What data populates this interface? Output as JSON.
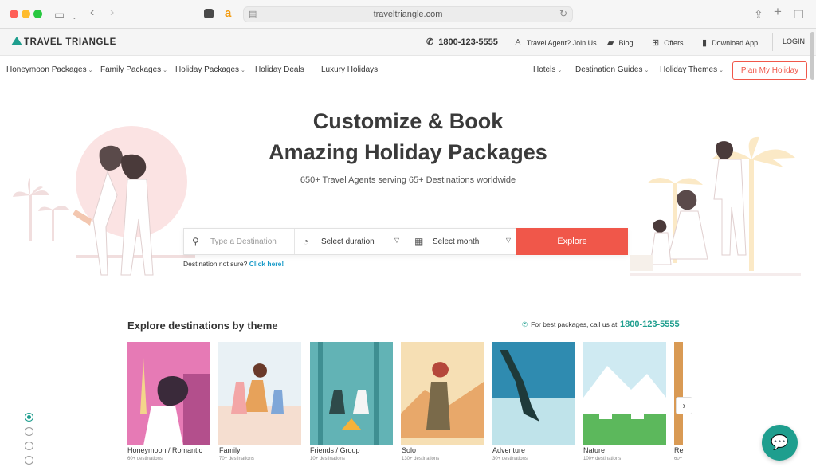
{
  "browser": {
    "url": "traveltriangle.com"
  },
  "topbar": {
    "logo": "TRAVEL TRIANGLE",
    "phone": "1800-123-5555",
    "travel_agent": "Travel Agent? Join Us",
    "blog": "Blog",
    "offers": "Offers",
    "download_app": "Download App",
    "login": "LOGIN"
  },
  "nav": {
    "items_left": [
      "Honeymoon Packages",
      "Family Packages",
      "Holiday Packages",
      "Holiday Deals",
      "Luxury Holidays"
    ],
    "items_right": [
      "Hotels",
      "Destination Guides",
      "Holiday Themes"
    ],
    "plan_button": "Plan My Holiday"
  },
  "hero": {
    "title_line1": "Customize & Book",
    "title_line2": "Amazing Holiday Packages",
    "subtitle": "650+ Travel Agents serving 65+ Destinations worldwide"
  },
  "search": {
    "destination_placeholder": "Type a Destination",
    "duration": "Select duration",
    "month": "Select month",
    "explore": "Explore",
    "not_sure_text": "Destination not sure?",
    "click_here": "Click here!"
  },
  "themes": {
    "title": "Explore destinations by theme",
    "callus_text": "For best packages, call us at",
    "callus_number": "1800-123-5555",
    "cards": [
      {
        "name": "Honeymoon / Romantic",
        "sub": "60+ destinations"
      },
      {
        "name": "Family",
        "sub": "70+ destinations"
      },
      {
        "name": "Friends / Group",
        "sub": "10+ destinations"
      },
      {
        "name": "Solo",
        "sub": "130+ destinations"
      },
      {
        "name": "Adventure",
        "sub": "30+ destinations"
      },
      {
        "name": "Nature",
        "sub": "100+ destinations"
      },
      {
        "name": "Re",
        "sub": "60+"
      }
    ]
  },
  "colors": {
    "accent": "#1e9e8e",
    "cta": "#f0574a"
  }
}
